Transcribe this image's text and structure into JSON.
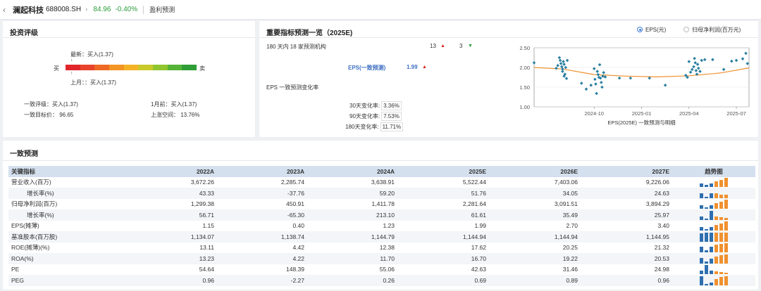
{
  "header": {
    "back_icon": "chevron-left-icon",
    "stock_name": "澜起科技",
    "stock_code": "688008.SH",
    "price": "84.96",
    "change": "-0.40%",
    "page": "盈利预测",
    "colors": {
      "down": "#2a9d3a",
      "up": "#d42a2a"
    }
  },
  "rating": {
    "title": "投资评级",
    "buy_label": "买",
    "sell_label": "卖",
    "latest": "最新：买入(1.37)",
    "last_month": "上月：：买入(1.37)",
    "consensus_rating": "一致评级：买入(1.37)",
    "one_month_ago": "1月前：买入(1.37)",
    "target_price": "一致目标价：  96.65",
    "upside": "上涨空间：  13.76%",
    "scale_colors": [
      "#e0262b",
      "#e8432a",
      "#ee6a24",
      "#f39424",
      "#f4b326",
      "#c9c92a",
      "#8fc52f",
      "#55b336",
      "#2f9e36"
    ]
  },
  "forecast": {
    "title": "重要指标预测一览（2025E)",
    "radio_eps": "EPS(元)",
    "radio_profit": "归母净利润(百万元)",
    "institutions": "180 天内 18 家预测机构",
    "up_count": "13",
    "down_count": "3",
    "eps_label": "EPS(一致预测)",
    "eps_value": "1.99",
    "change_title": "EPS 一致预测变化率",
    "changes": [
      {
        "label": "30天变化率:",
        "value": "3.36%"
      },
      {
        "label": "90天变化率:",
        "value": "7.53%"
      },
      {
        "label": "180天变化率:",
        "value": "11.71%"
      }
    ],
    "chart_caption": "EPS(2025E) 一致预测与明细"
  },
  "chart_data": {
    "type": "scatter",
    "title": "",
    "xlabel": "EPS(2025E) 一致预测与明细",
    "ylabel": "",
    "ylim": [
      1.0,
      2.5
    ],
    "yticks": [
      "2.50",
      "2.00",
      "1.50",
      "1.00"
    ],
    "xticks": [
      "2024-10",
      "2025-01",
      "2025-04",
      "2025-07"
    ],
    "xticks_pos_month": [
      0,
      3,
      6,
      9
    ],
    "xlim_month": [
      -3.8,
      9.8
    ],
    "series": [
      {
        "kind": "points",
        "color": "#2a7fa0",
        "points_month": [
          [
            -3.8,
            2.12
          ],
          [
            -2.4,
            1.98
          ],
          [
            -2.3,
            2.05
          ],
          [
            -2.2,
            2.25
          ],
          [
            -2.15,
            2.18
          ],
          [
            -2.1,
            2.1
          ],
          [
            -2.05,
            2.02
          ],
          [
            -2.0,
            1.96
          ],
          [
            -2.0,
            1.9
          ],
          [
            -1.95,
            2.15
          ],
          [
            -1.9,
            2.08
          ],
          [
            -1.9,
            1.78
          ],
          [
            -1.85,
            1.83
          ],
          [
            -1.8,
            2.0
          ],
          [
            -1.75,
            1.72
          ],
          [
            -1.7,
            2.18
          ],
          [
            -0.8,
            1.6
          ],
          [
            -0.5,
            1.45
          ],
          [
            -0.2,
            1.55
          ],
          [
            0.0,
            1.97
          ],
          [
            0.05,
            1.7
          ],
          [
            0.1,
            1.58
          ],
          [
            0.15,
            1.34
          ],
          [
            0.2,
            1.9
          ],
          [
            0.25,
            1.82
          ],
          [
            0.3,
            1.75
          ],
          [
            0.35,
            2.07
          ],
          [
            0.4,
            1.73
          ],
          [
            0.45,
            1.62
          ],
          [
            0.5,
            1.5
          ],
          [
            0.55,
            1.78
          ],
          [
            0.6,
            1.87
          ],
          [
            0.7,
            1.76
          ],
          [
            1.6,
            1.73
          ],
          [
            2.3,
            1.73
          ],
          [
            3.5,
            1.73
          ],
          [
            4.5,
            1.55
          ],
          [
            5.8,
            1.8
          ],
          [
            5.9,
            1.75
          ],
          [
            6.0,
            2.15
          ],
          [
            6.1,
            1.88
          ],
          [
            6.2,
            1.95
          ],
          [
            6.3,
            2.02
          ],
          [
            6.35,
            2.23
          ],
          [
            6.4,
            2.12
          ],
          [
            6.45,
            1.92
          ],
          [
            6.5,
            1.83
          ],
          [
            6.55,
            2.08
          ],
          [
            6.6,
            1.98
          ],
          [
            6.7,
            1.9
          ],
          [
            6.8,
            2.18
          ],
          [
            7.0,
            2.2
          ],
          [
            7.5,
            2.2
          ],
          [
            8.2,
            1.95
          ],
          [
            8.7,
            2.16
          ],
          [
            9.0,
            2.18
          ],
          [
            9.4,
            2.22
          ],
          [
            9.6,
            2.36
          ],
          [
            9.7,
            2.1
          ]
        ]
      },
      {
        "kind": "line",
        "color": "#f0912f",
        "points_month": [
          [
            -3.8,
            2.0
          ],
          [
            -2.0,
            1.96
          ],
          [
            0.0,
            1.82
          ],
          [
            2.0,
            1.78
          ],
          [
            4.0,
            1.76
          ],
          [
            6.0,
            1.79
          ],
          [
            8.0,
            1.86
          ],
          [
            9.8,
            1.99
          ]
        ]
      }
    ]
  },
  "consensus": {
    "title": "一致预测",
    "columns": [
      "关键指标",
      "2022A",
      "2023A",
      "2024A",
      "2025E",
      "2026E",
      "2027E",
      "趋势图"
    ],
    "rows": [
      {
        "name": "营业收入(百万)",
        "indent": false,
        "values": [
          "3,672.26",
          "2,285.74",
          "3,638.91",
          "5,522.44",
          "7,403.06",
          "9,226.06"
        ],
        "trend": [
          0.4,
          0.25,
          0.4,
          0.6,
          0.8,
          1.0
        ]
      },
      {
        "name": "增长率(%)",
        "indent": true,
        "values": [
          "43.33",
          "-37.76",
          "59.20",
          "51.76",
          "34.05",
          "24.63"
        ],
        "trend": [
          0.5,
          0.1,
          0.55,
          0.5,
          0.4,
          0.35
        ]
      },
      {
        "name": "归母净利润(百万)",
        "indent": false,
        "values": [
          "1,299.38",
          "450.91",
          "1,411.78",
          "2,281.64",
          "3,091.51",
          "3,894.29"
        ],
        "trend": [
          0.35,
          0.12,
          0.36,
          0.6,
          0.8,
          1.0
        ]
      },
      {
        "name": "增长率(%)",
        "indent": true,
        "values": [
          "56.71",
          "-65.30",
          "213.10",
          "61.61",
          "35.49",
          "25.97"
        ],
        "trend": [
          0.35,
          0.08,
          1.0,
          0.35,
          0.3,
          0.25
        ]
      },
      {
        "name": "EPS(摊薄)",
        "indent": false,
        "values": [
          "1.15",
          "0.40",
          "1.23",
          "1.99",
          "2.70",
          "3.40"
        ],
        "trend": [
          0.35,
          0.12,
          0.36,
          0.6,
          0.8,
          1.0
        ]
      },
      {
        "name": "基准股本(百万股)",
        "indent": false,
        "values": [
          "1,134.07",
          "1,138.74",
          "1,144.79",
          "1,144.94",
          "1,144.94",
          "1,144.95"
        ],
        "trend": [
          0.95,
          0.97,
          1.0,
          1.0,
          1.0,
          1.0
        ]
      },
      {
        "name": "ROE(摊薄)(%)",
        "indent": false,
        "values": [
          "13.11",
          "4.42",
          "12.38",
          "17.62",
          "20.25",
          "21.32"
        ],
        "trend": [
          0.6,
          0.2,
          0.58,
          0.82,
          0.95,
          1.0
        ]
      },
      {
        "name": "ROA(%)",
        "indent": false,
        "values": [
          "13.23",
          "4.22",
          "11.70",
          "16.70",
          "19.22",
          "20.53"
        ],
        "trend": [
          0.62,
          0.2,
          0.56,
          0.8,
          0.93,
          1.0
        ]
      },
      {
        "name": "PE",
        "indent": false,
        "highlight": true,
        "values": [
          "54.64",
          "148.39",
          "55.06",
          "42.63",
          "31.46",
          "24.98"
        ],
        "trend": [
          0.4,
          1.0,
          0.4,
          0.3,
          0.22,
          0.18
        ]
      },
      {
        "name": "PEG",
        "indent": false,
        "values": [
          "0.96",
          "-2.27",
          "0.26",
          "0.69",
          "0.89",
          "0.96"
        ],
        "trend": [
          1.0,
          0.1,
          0.3,
          0.7,
          0.9,
          1.0
        ]
      }
    ],
    "trend_colors": {
      "actual": "#2f6fb0",
      "estimate": "#f0912f"
    }
  }
}
